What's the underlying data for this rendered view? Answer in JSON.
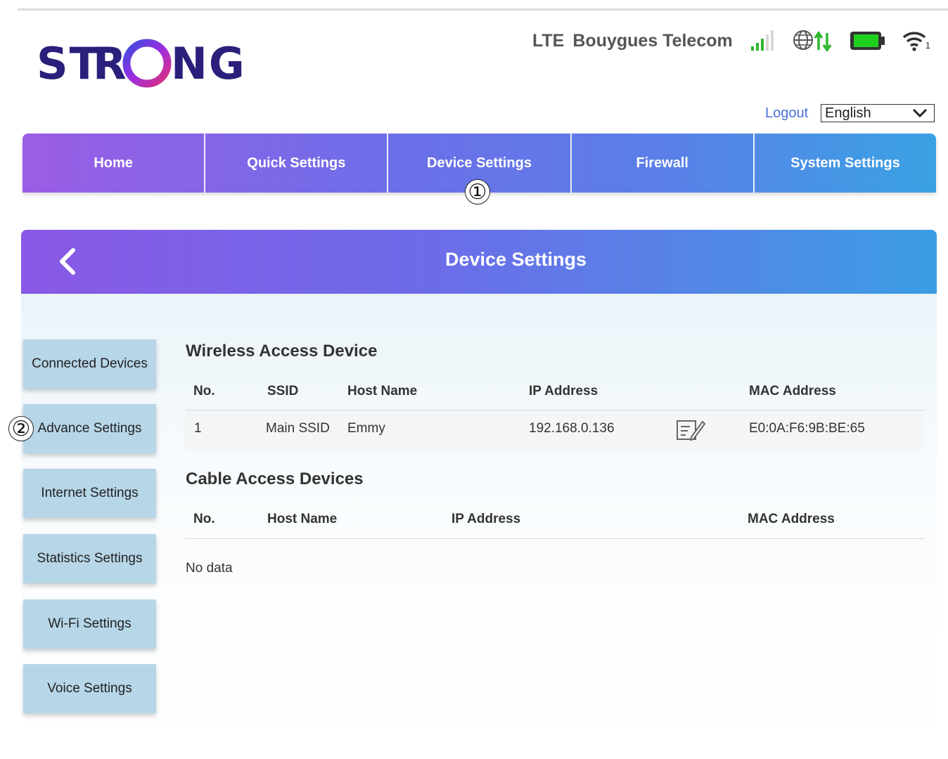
{
  "brand": {
    "logo_text": "STRONG"
  },
  "status_bar": {
    "network_type": "LTE",
    "operator": "Bouygues Telecom",
    "icons": [
      "signal-bars-icon",
      "globe-data-icon",
      "battery-icon",
      "wifi-icon"
    ],
    "wifi_clients": "1",
    "colors": {
      "signal": "#2fb52f",
      "data_arrows": "#2fb52f",
      "battery": "#1fd11f"
    }
  },
  "account": {
    "logout_label": "Logout",
    "language": "English"
  },
  "nav": {
    "items": [
      {
        "label": "Home"
      },
      {
        "label": "Quick Settings"
      },
      {
        "label": "Device Settings"
      },
      {
        "label": "Firewall"
      },
      {
        "label": "System Settings"
      }
    ]
  },
  "callouts": {
    "one": "①",
    "two": "②"
  },
  "page": {
    "title": "Device Settings"
  },
  "sidebar": {
    "items": [
      {
        "label": "Connected Devices"
      },
      {
        "label": "Advance Settings"
      },
      {
        "label": "Internet Settings"
      },
      {
        "label": "Statistics Settings"
      },
      {
        "label": "Wi-Fi Settings"
      },
      {
        "label": "Voice Settings"
      }
    ]
  },
  "wireless": {
    "title": "Wireless Access Device",
    "headers": [
      "No.",
      "SSID",
      "Host Name",
      "IP Address",
      "MAC Address"
    ],
    "rows": [
      {
        "no": "1",
        "ssid": "Main SSID",
        "host": "Emmy",
        "ip": "192.168.0.136",
        "mac": "E0:0A:F6:9B:BE:65"
      }
    ]
  },
  "cable": {
    "title": "Cable Access Devices",
    "headers": [
      "No.",
      "Host Name",
      "IP Address",
      "MAC Address"
    ],
    "empty_text": "No data"
  }
}
